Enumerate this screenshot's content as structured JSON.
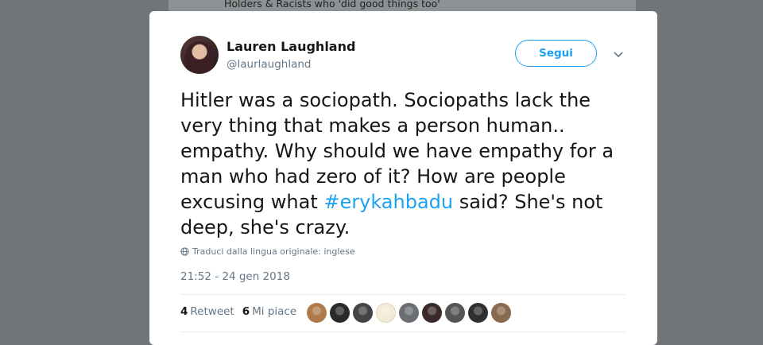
{
  "background": {
    "text": "Holders & Racists who 'did good things too'"
  },
  "tweet": {
    "author_name": "Lauren Laughland",
    "author_handle": "@laurlaughland",
    "follow_label": "Segui",
    "text_parts": [
      {
        "text": "Hitler was a sociopath. Sociopaths lack the very thing that makes a person human.. empathy. Why should we have empathy for a man who had zero of it? How are people excusing what ",
        "type": "text"
      },
      {
        "text": "#erykahbadu",
        "type": "hashtag"
      },
      {
        "text": " said? She's not deep, she's crazy.",
        "type": "text"
      }
    ],
    "translate_label": "Traduci dalla lingua originale: inglese",
    "timestamp": "21:52 - 24 gen 2018",
    "retweets": {
      "count": "4",
      "label": "Retweet"
    },
    "likes": {
      "count": "6",
      "label": "Mi piace"
    },
    "likers": [
      "#b07a4a",
      "#2a2a2a",
      "#444444",
      "#f3ead8",
      "#6b6f73",
      "#3a2a2a",
      "#555555",
      "#2f2f2f",
      "#8a6a4f"
    ]
  },
  "colors": {
    "accent": "#1da1f2",
    "text": "#14171a",
    "muted": "#657786"
  }
}
